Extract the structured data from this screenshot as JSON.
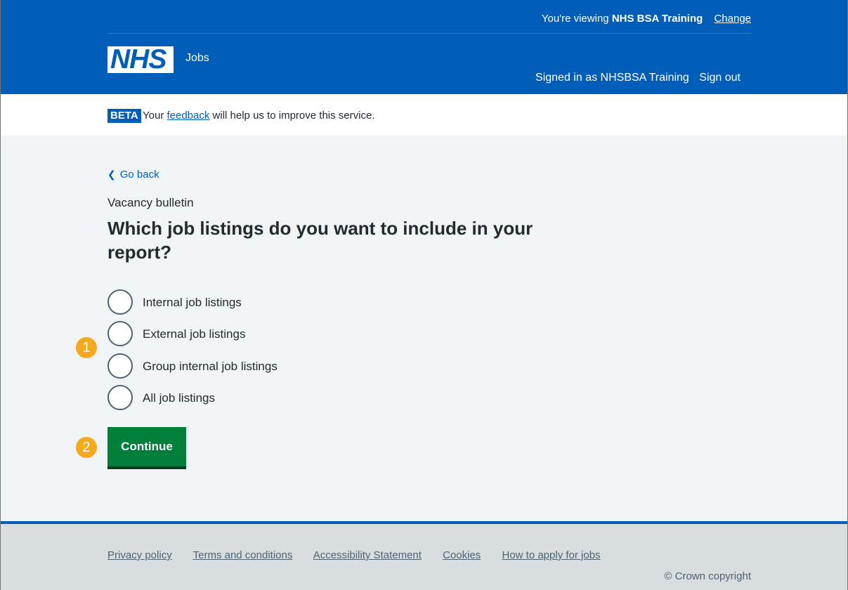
{
  "header": {
    "viewing_prefix": "You're viewing",
    "viewing_org": "NHS BSA Training",
    "change_link": "Change",
    "logo_text": "NHS",
    "service_name": "Jobs",
    "signed_in_as": "Signed in as NHSBSA Training",
    "sign_out": "Sign out"
  },
  "beta": {
    "tag": "BETA",
    "text_before": "Your",
    "link": "feedback",
    "text_after": "will help us to improve this service."
  },
  "main": {
    "back_link": "Go back",
    "caption": "Vacancy bulletin",
    "heading": "Which job listings do you want to include in your report?",
    "options": [
      {
        "label": "Internal job listings"
      },
      {
        "label": "External job listings"
      },
      {
        "label": "Group internal job listings"
      },
      {
        "label": "All job listings"
      }
    ],
    "continue_label": "Continue"
  },
  "annotations": [
    {
      "number": "1",
      "color": "#f5a91e"
    },
    {
      "number": "2",
      "color": "#f5a91e"
    }
  ],
  "footer": {
    "links": [
      "Privacy policy",
      "Terms and conditions",
      "Accessibility Statement",
      "Cookies",
      "How to apply for jobs"
    ],
    "copyright": "© Crown copyright"
  },
  "colors": {
    "nhs_blue": "#005eb8",
    "button_green": "#007f3b",
    "badge_orange": "#f5a91e",
    "page_background": "#f0f4f5",
    "footer_background": "#d8dde0"
  }
}
